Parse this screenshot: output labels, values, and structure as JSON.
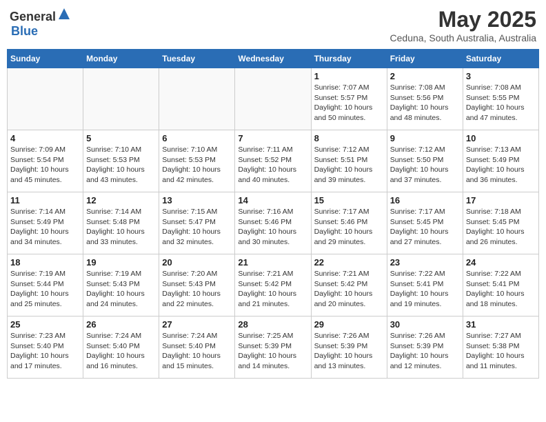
{
  "header": {
    "logo_general": "General",
    "logo_blue": "Blue",
    "month": "May 2025",
    "location": "Ceduna, South Australia, Australia"
  },
  "weekdays": [
    "Sunday",
    "Monday",
    "Tuesday",
    "Wednesday",
    "Thursday",
    "Friday",
    "Saturday"
  ],
  "weeks": [
    [
      {
        "day": "",
        "info": ""
      },
      {
        "day": "",
        "info": ""
      },
      {
        "day": "",
        "info": ""
      },
      {
        "day": "",
        "info": ""
      },
      {
        "day": "1",
        "info": "Sunrise: 7:07 AM\nSunset: 5:57 PM\nDaylight: 10 hours\nand 50 minutes."
      },
      {
        "day": "2",
        "info": "Sunrise: 7:08 AM\nSunset: 5:56 PM\nDaylight: 10 hours\nand 48 minutes."
      },
      {
        "day": "3",
        "info": "Sunrise: 7:08 AM\nSunset: 5:55 PM\nDaylight: 10 hours\nand 47 minutes."
      }
    ],
    [
      {
        "day": "4",
        "info": "Sunrise: 7:09 AM\nSunset: 5:54 PM\nDaylight: 10 hours\nand 45 minutes."
      },
      {
        "day": "5",
        "info": "Sunrise: 7:10 AM\nSunset: 5:53 PM\nDaylight: 10 hours\nand 43 minutes."
      },
      {
        "day": "6",
        "info": "Sunrise: 7:10 AM\nSunset: 5:53 PM\nDaylight: 10 hours\nand 42 minutes."
      },
      {
        "day": "7",
        "info": "Sunrise: 7:11 AM\nSunset: 5:52 PM\nDaylight: 10 hours\nand 40 minutes."
      },
      {
        "day": "8",
        "info": "Sunrise: 7:12 AM\nSunset: 5:51 PM\nDaylight: 10 hours\nand 39 minutes."
      },
      {
        "day": "9",
        "info": "Sunrise: 7:12 AM\nSunset: 5:50 PM\nDaylight: 10 hours\nand 37 minutes."
      },
      {
        "day": "10",
        "info": "Sunrise: 7:13 AM\nSunset: 5:49 PM\nDaylight: 10 hours\nand 36 minutes."
      }
    ],
    [
      {
        "day": "11",
        "info": "Sunrise: 7:14 AM\nSunset: 5:49 PM\nDaylight: 10 hours\nand 34 minutes."
      },
      {
        "day": "12",
        "info": "Sunrise: 7:14 AM\nSunset: 5:48 PM\nDaylight: 10 hours\nand 33 minutes."
      },
      {
        "day": "13",
        "info": "Sunrise: 7:15 AM\nSunset: 5:47 PM\nDaylight: 10 hours\nand 32 minutes."
      },
      {
        "day": "14",
        "info": "Sunrise: 7:16 AM\nSunset: 5:46 PM\nDaylight: 10 hours\nand 30 minutes."
      },
      {
        "day": "15",
        "info": "Sunrise: 7:17 AM\nSunset: 5:46 PM\nDaylight: 10 hours\nand 29 minutes."
      },
      {
        "day": "16",
        "info": "Sunrise: 7:17 AM\nSunset: 5:45 PM\nDaylight: 10 hours\nand 27 minutes."
      },
      {
        "day": "17",
        "info": "Sunrise: 7:18 AM\nSunset: 5:45 PM\nDaylight: 10 hours\nand 26 minutes."
      }
    ],
    [
      {
        "day": "18",
        "info": "Sunrise: 7:19 AM\nSunset: 5:44 PM\nDaylight: 10 hours\nand 25 minutes."
      },
      {
        "day": "19",
        "info": "Sunrise: 7:19 AM\nSunset: 5:43 PM\nDaylight: 10 hours\nand 24 minutes."
      },
      {
        "day": "20",
        "info": "Sunrise: 7:20 AM\nSunset: 5:43 PM\nDaylight: 10 hours\nand 22 minutes."
      },
      {
        "day": "21",
        "info": "Sunrise: 7:21 AM\nSunset: 5:42 PM\nDaylight: 10 hours\nand 21 minutes."
      },
      {
        "day": "22",
        "info": "Sunrise: 7:21 AM\nSunset: 5:42 PM\nDaylight: 10 hours\nand 20 minutes."
      },
      {
        "day": "23",
        "info": "Sunrise: 7:22 AM\nSunset: 5:41 PM\nDaylight: 10 hours\nand 19 minutes."
      },
      {
        "day": "24",
        "info": "Sunrise: 7:22 AM\nSunset: 5:41 PM\nDaylight: 10 hours\nand 18 minutes."
      }
    ],
    [
      {
        "day": "25",
        "info": "Sunrise: 7:23 AM\nSunset: 5:40 PM\nDaylight: 10 hours\nand 17 minutes."
      },
      {
        "day": "26",
        "info": "Sunrise: 7:24 AM\nSunset: 5:40 PM\nDaylight: 10 hours\nand 16 minutes."
      },
      {
        "day": "27",
        "info": "Sunrise: 7:24 AM\nSunset: 5:40 PM\nDaylight: 10 hours\nand 15 minutes."
      },
      {
        "day": "28",
        "info": "Sunrise: 7:25 AM\nSunset: 5:39 PM\nDaylight: 10 hours\nand 14 minutes."
      },
      {
        "day": "29",
        "info": "Sunrise: 7:26 AM\nSunset: 5:39 PM\nDaylight: 10 hours\nand 13 minutes."
      },
      {
        "day": "30",
        "info": "Sunrise: 7:26 AM\nSunset: 5:39 PM\nDaylight: 10 hours\nand 12 minutes."
      },
      {
        "day": "31",
        "info": "Sunrise: 7:27 AM\nSunset: 5:38 PM\nDaylight: 10 hours\nand 11 minutes."
      }
    ]
  ]
}
